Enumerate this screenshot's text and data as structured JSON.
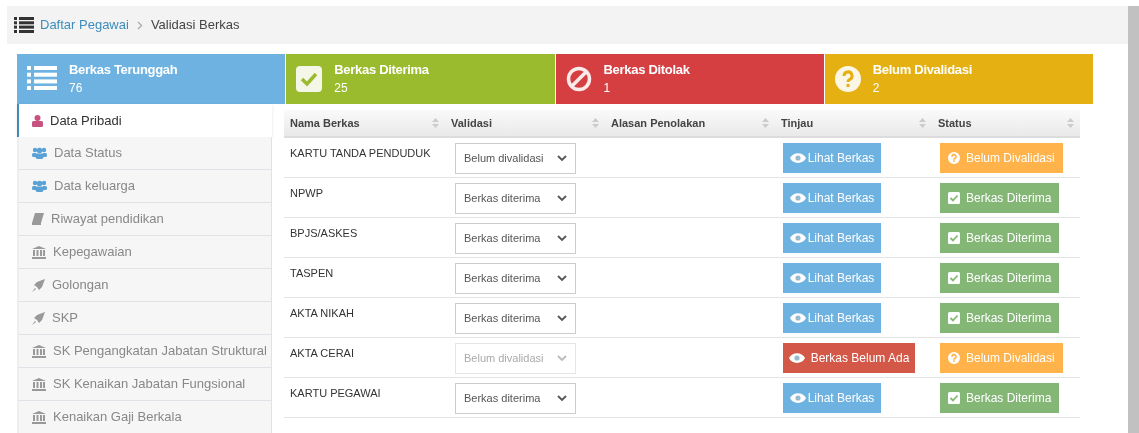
{
  "breadcrumb": [
    {
      "label": "Daftar Pegawai",
      "kind": "link"
    },
    {
      "label": "Validasi Berkas",
      "kind": "current"
    }
  ],
  "stats": [
    {
      "kind": "uploaded",
      "title": "Berkas Terunggah",
      "count": "76"
    },
    {
      "kind": "accepted",
      "title": "Berkas Diterima",
      "count": "25"
    },
    {
      "kind": "rejected",
      "title": "Berkas Ditolak",
      "count": "1"
    },
    {
      "kind": "pending",
      "title": "Belum Divalidasi",
      "count": "2"
    }
  ],
  "sidebar": {
    "items": [
      {
        "label": "Data Pribadi",
        "kind": "profile",
        "selected": true
      },
      {
        "label": "Data Status",
        "kind": "group",
        "selected": false
      },
      {
        "label": "Data keluarga",
        "kind": "group",
        "selected": false
      },
      {
        "label": "Riwayat pendidikan",
        "kind": "education",
        "selected": false
      },
      {
        "label": "Kepegawaian",
        "kind": "institution",
        "selected": false
      },
      {
        "label": "Golongan",
        "kind": "rocket",
        "selected": false
      },
      {
        "label": "SKP",
        "kind": "rocket",
        "selected": false
      },
      {
        "label": "SK Pengangkatan Jabatan Struktural",
        "kind": "institution",
        "selected": false
      },
      {
        "label": "SK Kenaikan Jabatan Fungsional",
        "kind": "institution",
        "selected": false
      },
      {
        "label": "Kenaikan Gaji Berkala",
        "kind": "institution",
        "selected": false
      }
    ]
  },
  "table": {
    "columns": [
      "Nama Berkas",
      "Validasi",
      "Alasan Penolakan",
      "Tinjau",
      "Status"
    ],
    "rows": [
      {
        "name": "KARTU TANDA PENDUDUK",
        "validation": {
          "value": "Belum divalidasi",
          "disabled": false
        },
        "review": {
          "kind": "view",
          "label": "Lihat Berkas"
        },
        "status": {
          "kind": "pending",
          "label": "Belum Divalidasi"
        }
      },
      {
        "name": "NPWP",
        "validation": {
          "value": "Berkas diterima",
          "disabled": false
        },
        "review": {
          "kind": "view",
          "label": "Lihat Berkas"
        },
        "status": {
          "kind": "accepted",
          "label": "Berkas Diterima"
        }
      },
      {
        "name": "BPJS/ASKES",
        "validation": {
          "value": "Berkas diterima",
          "disabled": false
        },
        "review": {
          "kind": "view",
          "label": "Lihat Berkas"
        },
        "status": {
          "kind": "accepted",
          "label": "Berkas Diterima"
        }
      },
      {
        "name": "TASPEN",
        "validation": {
          "value": "Berkas diterima",
          "disabled": false
        },
        "review": {
          "kind": "view",
          "label": "Lihat Berkas"
        },
        "status": {
          "kind": "accepted",
          "label": "Berkas Diterima"
        }
      },
      {
        "name": "AKTA NIKAH",
        "validation": {
          "value": "Berkas diterima",
          "disabled": false
        },
        "review": {
          "kind": "view",
          "label": "Lihat Berkas"
        },
        "status": {
          "kind": "accepted",
          "label": "Berkas Diterima"
        }
      },
      {
        "name": "AKTA CERAI",
        "validation": {
          "value": "Belum divalidasi",
          "disabled": true
        },
        "review": {
          "kind": "missing",
          "label": "Berkas Belum Ada"
        },
        "status": {
          "kind": "pending",
          "label": "Belum Divalidasi"
        }
      },
      {
        "name": "KARTU PEGAWAI",
        "validation": {
          "value": "Berkas diterima",
          "disabled": false
        },
        "review": {
          "kind": "view",
          "label": "Lihat Berkas"
        },
        "status": {
          "kind": "accepted",
          "label": "Berkas Diterima"
        }
      }
    ]
  }
}
